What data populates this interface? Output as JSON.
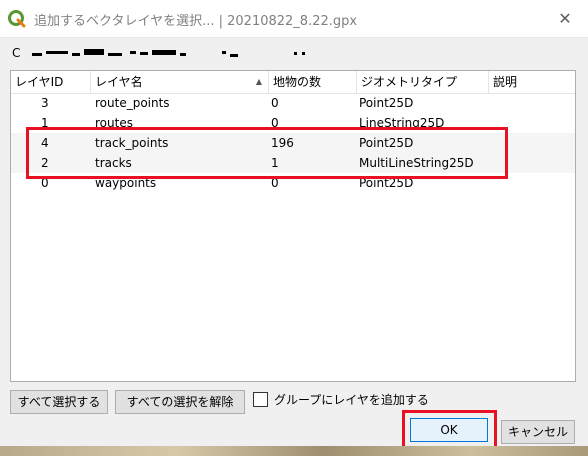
{
  "window": {
    "title": "追加するベクタレイヤを選択... | 20210822_8.22.gpx",
    "close_glyph": "✕"
  },
  "path": {
    "label": "C"
  },
  "table": {
    "columns": [
      {
        "label": "レイヤID"
      },
      {
        "label": "レイヤ名",
        "sorted": true,
        "sort_glyph": "▲"
      },
      {
        "label": "地物の数"
      },
      {
        "label": "ジオメトリタイプ"
      },
      {
        "label": "説明"
      }
    ],
    "rows": [
      {
        "id": "3",
        "name": "route_points",
        "count": "0",
        "geometry": "Point25D",
        "desc": ""
      },
      {
        "id": "1",
        "name": "routes",
        "count": "0",
        "geometry": "LineString25D",
        "desc": ""
      },
      {
        "id": "4",
        "name": "track_points",
        "count": "196",
        "geometry": "Point25D",
        "desc": ""
      },
      {
        "id": "2",
        "name": "tracks",
        "count": "1",
        "geometry": "MultiLineString25D",
        "desc": ""
      },
      {
        "id": "0",
        "name": "waypoints",
        "count": "0",
        "geometry": "Point25D",
        "desc": ""
      }
    ]
  },
  "buttons": {
    "select_all": "すべて選択する",
    "deselect_all": "すべての選択を解除",
    "add_to_group": "グループにレイヤを追加する",
    "ok": "OK",
    "cancel": "キャンセル"
  },
  "colors": {
    "highlight": "#e81123",
    "ok_border": "#0078d7"
  }
}
